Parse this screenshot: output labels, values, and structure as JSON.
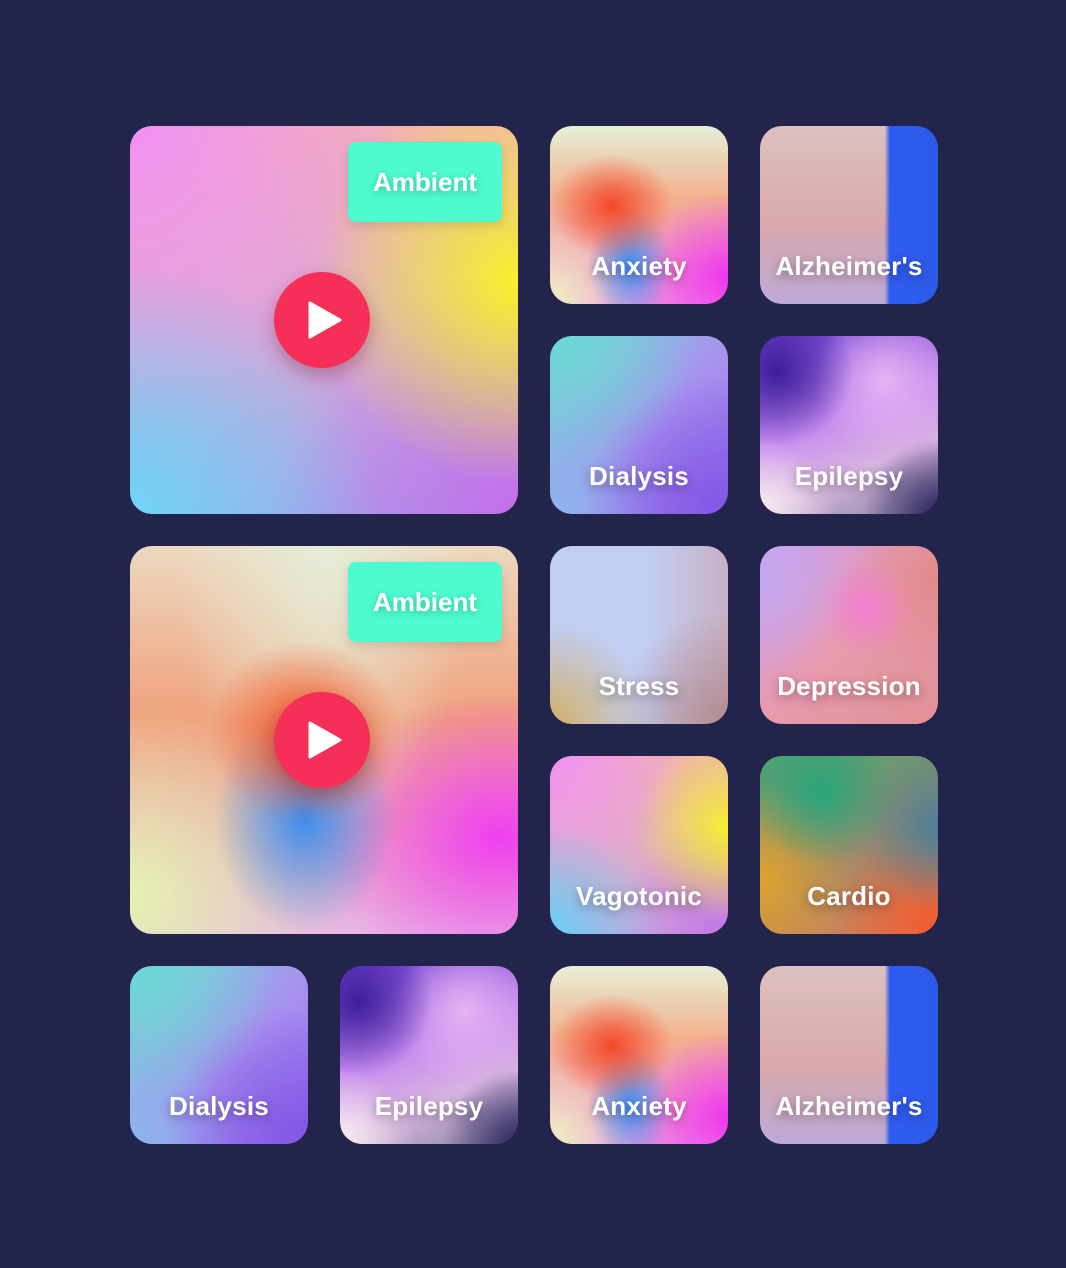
{
  "featured": [
    {
      "badge": "Ambient"
    },
    {
      "badge": "Ambient"
    }
  ],
  "tiles": [
    {
      "label": "Anxiety"
    },
    {
      "label": "Alzheimer's"
    },
    {
      "label": "Dialysis"
    },
    {
      "label": "Epilepsy"
    },
    {
      "label": "Stress"
    },
    {
      "label": "Depression"
    },
    {
      "label": "Vagotonic"
    },
    {
      "label": "Cardio"
    },
    {
      "label": "Dialysis"
    },
    {
      "label": "Epilepsy"
    },
    {
      "label": "Anxiety"
    },
    {
      "label": "Alzheimer's"
    }
  ],
  "colors": {
    "background": "#22244b",
    "badge": "#4dfbd0",
    "play_button": "#f52f57"
  },
  "icons": {
    "play": "play-icon"
  }
}
